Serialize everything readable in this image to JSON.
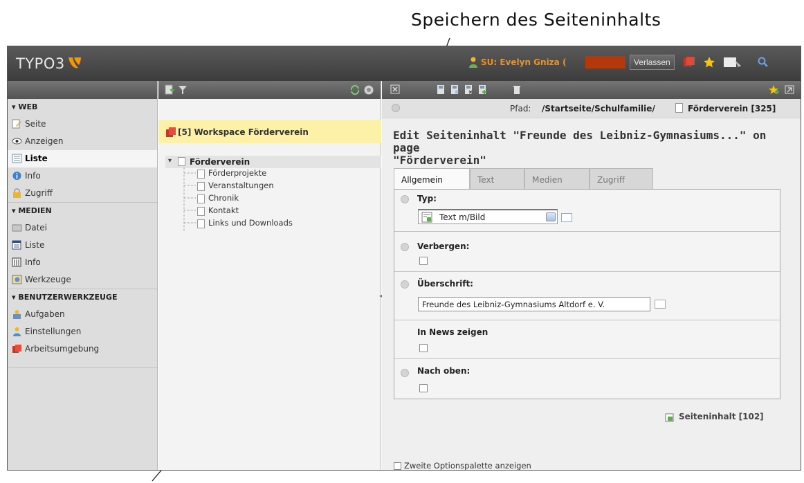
{
  "annotation": {
    "top_text": "Speichern des Seiteninhalts"
  },
  "topbar": {
    "logo": "TYPO3",
    "user_text": "SU: Evelyn Gniza (",
    "leave_button": "Verlassen",
    "icons": [
      "typo3-logo-icon",
      "user-icon",
      "workspace-icon",
      "bookmark-star-icon",
      "cache-icon",
      "search-icon"
    ]
  },
  "sidebar": {
    "groups": [
      {
        "title": "▾ WEB",
        "items": [
          {
            "label": "Seite",
            "icon": "page-edit-icon"
          },
          {
            "label": "Anzeigen",
            "icon": "view-icon"
          },
          {
            "label": "Liste",
            "icon": "list-icon",
            "active": true
          },
          {
            "label": "Info",
            "icon": "info-icon"
          },
          {
            "label": "Zugriff",
            "icon": "lock-icon"
          }
        ]
      },
      {
        "title": "▾ MEDIEN",
        "items": [
          {
            "label": "Datei",
            "icon": "folder-icon"
          },
          {
            "label": "Liste",
            "icon": "list-icon"
          },
          {
            "label": "Info",
            "icon": "info-icon"
          },
          {
            "label": "Werkzeuge",
            "icon": "tools-icon"
          }
        ]
      },
      {
        "title": "▾ BENUTZERWERKZEUGE",
        "items": [
          {
            "label": "Aufgaben",
            "icon": "tasks-icon"
          },
          {
            "label": "Einstellungen",
            "icon": "settings-icon"
          },
          {
            "label": "Arbeitsumgebung",
            "icon": "workspace-icon"
          }
        ]
      }
    ]
  },
  "tree": {
    "workspace": "[5] Workspace Förderverein",
    "root": "Förderverein",
    "children": [
      "Förderprojekte",
      "Veranstaltungen",
      "Chronik",
      "Kontakt",
      "Links und Downloads"
    ]
  },
  "content": {
    "path_label": "Pfad:",
    "path_value": "/Startseite/Schulfamilie/",
    "path_page": "Förderverein [325]",
    "edit_title_line1": "Edit Seiteninhalt \"Freunde des Leibniz-Gymnasiums...\" on page",
    "edit_title_line2": "\"Förderverein\"",
    "tabs": [
      "Allgemein",
      "Text",
      "Medien",
      "Zugriff"
    ],
    "fields": {
      "typ_label": "Typ:",
      "typ_value": "Text m/Bild",
      "verbergen_label": "Verbergen:",
      "ueberschrift_label": "Überschrift:",
      "ueberschrift_value": "Freunde des Leibniz-Gymnasiums Altdorf e. V.",
      "news_label": "In News zeigen",
      "nach_oben_label": "Nach oben:"
    },
    "record": "Seiteninhalt [102]",
    "second_options": "Zweite Optionspalette anzeigen"
  }
}
